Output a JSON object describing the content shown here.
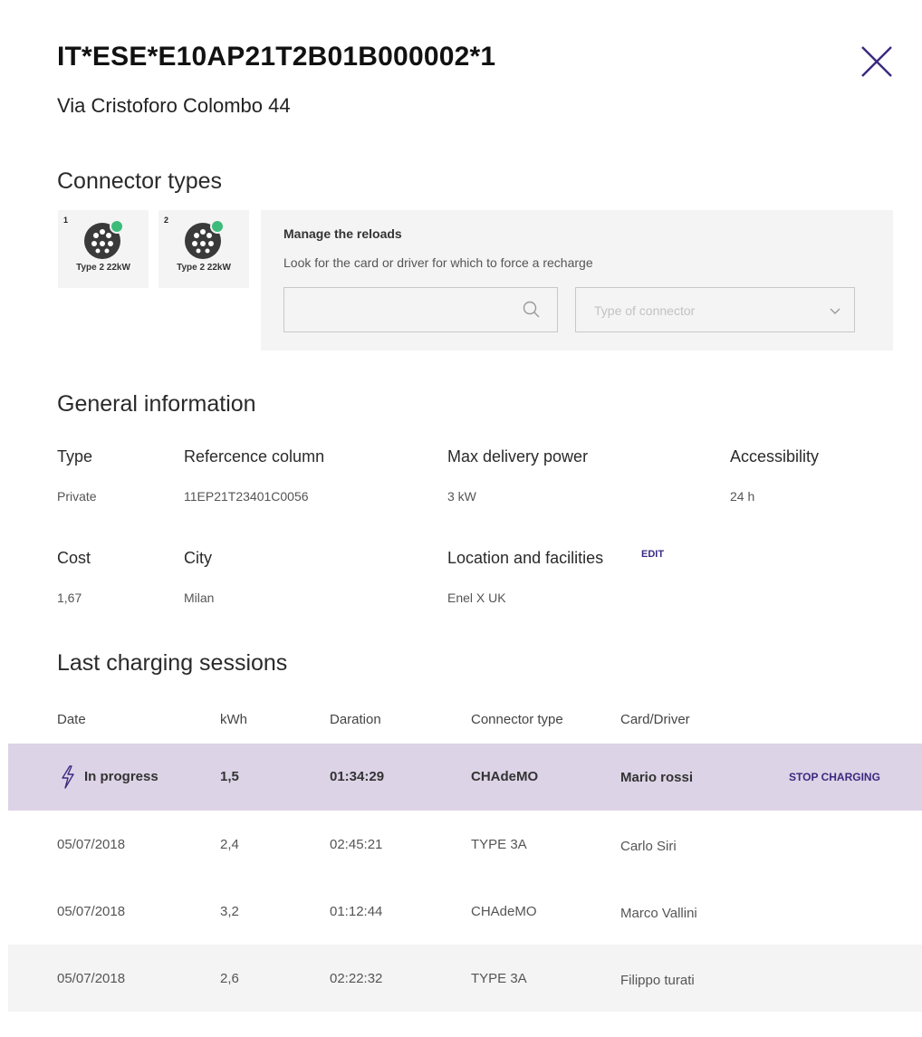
{
  "header": {
    "station_id": "IT*ESE*E10AP21T2B01B000002*1",
    "address": "Via Cristoforo Colombo 44",
    "close_icon": "close-icon"
  },
  "connectors": {
    "title": "Connector types",
    "items": [
      {
        "number": "1",
        "label": "Type 2 22kW",
        "status_color": "#3dbb7a"
      },
      {
        "number": "2",
        "label": "Type 2 22kW",
        "status_color": "#3dbb7a"
      }
    ]
  },
  "manage": {
    "title": "Manage the reloads",
    "description": "Look for the card or driver for which to force a recharge",
    "search_value": "",
    "connector_placeholder": "Type of connector"
  },
  "general": {
    "title": "General information",
    "type_label": "Type",
    "type_value": "Private",
    "reference_label": "Refercence column",
    "reference_value": "11EP21T23401C0056",
    "power_label": "Max delivery power",
    "power_value": "3 kW",
    "access_label": "Accessibility",
    "access_value": "24 h",
    "cost_label": "Cost",
    "cost_value": "1,67",
    "city_label": "City",
    "city_value": "Milan",
    "location_label": "Location and facilities",
    "location_value": "Enel X UK",
    "edit_label": "EDIT"
  },
  "sessions": {
    "title": "Last charging sessions",
    "columns": [
      "Date",
      "kWh",
      "Daration",
      "Connector type",
      "Card/Driver"
    ],
    "in_progress": {
      "status": "In progress",
      "kwh": "1,5",
      "duration": "01:34:29",
      "connector": "CHAdeMO",
      "driver": "Mario rossi",
      "action": "STOP CHARGING"
    },
    "rows": [
      {
        "date": "05/07/2018",
        "kwh": "2,4",
        "duration": "02:45:21",
        "connector": "TYPE 3A",
        "driver": "Carlo Siri"
      },
      {
        "date": "05/07/2018",
        "kwh": "3,2",
        "duration": "01:12:44",
        "connector": "CHAdeMO",
        "driver": "Marco Vallini"
      },
      {
        "date": "05/07/2018",
        "kwh": "2,6",
        "duration": "02:22:32",
        "connector": "TYPE 3A",
        "driver": "Filippo turati"
      }
    ]
  },
  "colors": {
    "accent": "#3b2a80",
    "in_progress_row": "#dcd3e6",
    "panel": "#f4f4f4",
    "status_dot": "#3dbb7a"
  }
}
